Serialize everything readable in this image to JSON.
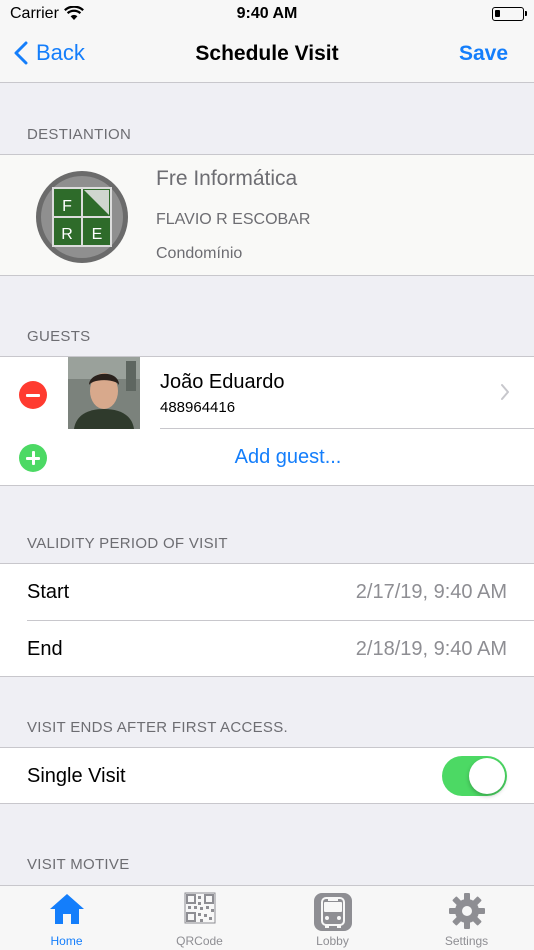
{
  "status_bar": {
    "carrier": "Carrier",
    "time": "9:40 AM"
  },
  "nav": {
    "back_label": "Back",
    "title": "Schedule Visit",
    "save_label": "Save"
  },
  "destination": {
    "header": "DESTIANTION",
    "name": "Fre Informática",
    "owner": "FLAVIO R ESCOBAR",
    "place": "Condomínio",
    "logo_letters": [
      "F",
      "R",
      "E"
    ]
  },
  "guests": {
    "header": "GUESTS",
    "items": [
      {
        "name": "João Eduardo",
        "phone": "488964416"
      }
    ],
    "add_label": "Add guest..."
  },
  "validity": {
    "header": "VALIDITY PERIOD OF VISIT",
    "start_label": "Start",
    "start_value": "2/17/19, 9:40 AM",
    "end_label": "End",
    "end_value": "2/18/19, 9:40 AM"
  },
  "single_visit": {
    "header": "VISIT ENDS AFTER FIRST ACCESS.",
    "label": "Single Visit",
    "enabled": true
  },
  "visit_motive": {
    "header": "VISIT MOTIVE"
  },
  "tabs": [
    {
      "label": "Home",
      "icon": "home-icon",
      "active": true
    },
    {
      "label": "QRCode",
      "icon": "qrcode-icon",
      "active": false
    },
    {
      "label": "Lobby",
      "icon": "bus-icon",
      "active": false
    },
    {
      "label": "Settings",
      "icon": "gear-icon",
      "active": false
    }
  ],
  "colors": {
    "accent": "#147efb",
    "remove": "#ff3b30",
    "add": "#4cd964",
    "background": "#efeff4"
  }
}
